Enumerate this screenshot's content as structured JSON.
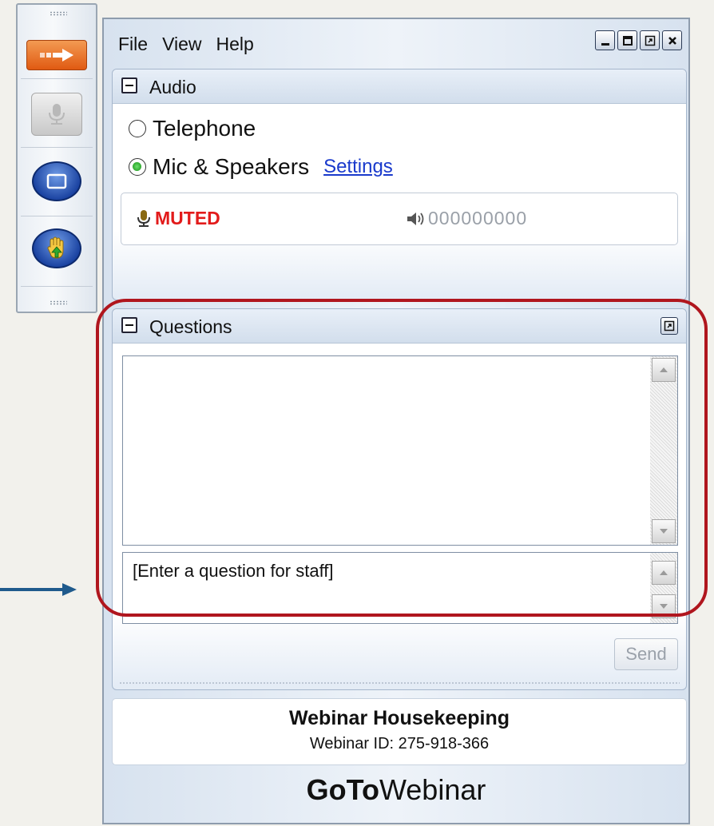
{
  "menu": [
    "File",
    "View",
    "Help"
  ],
  "audio": {
    "title": "Audio",
    "options": [
      "Telephone",
      "Mic & Speakers"
    ],
    "selected": "Mic & Speakers",
    "settings_label": "Settings",
    "mic_status": "MUTED",
    "volume_meter": "000000000"
  },
  "questions": {
    "title": "Questions",
    "input_placeholder": "[Enter a question for staff]",
    "send_label": "Send"
  },
  "footer": {
    "title": "Webinar Housekeeping",
    "webinar_id": "Webinar ID: 275-918-366"
  },
  "brand": {
    "bold": "GoTo",
    "rest": "Webinar"
  },
  "colors": {
    "highlight": "#b0161e",
    "arrow": "#1f5a8c",
    "muted": "#e21b1b",
    "link": "#1a3acc"
  },
  "icons": [
    "arrow-icon",
    "mic-icon",
    "screen-icon",
    "hand-icon",
    "minimize-icon",
    "maximize-icon",
    "restore-icon",
    "close-icon",
    "popout-icon",
    "speaker-icon"
  ]
}
